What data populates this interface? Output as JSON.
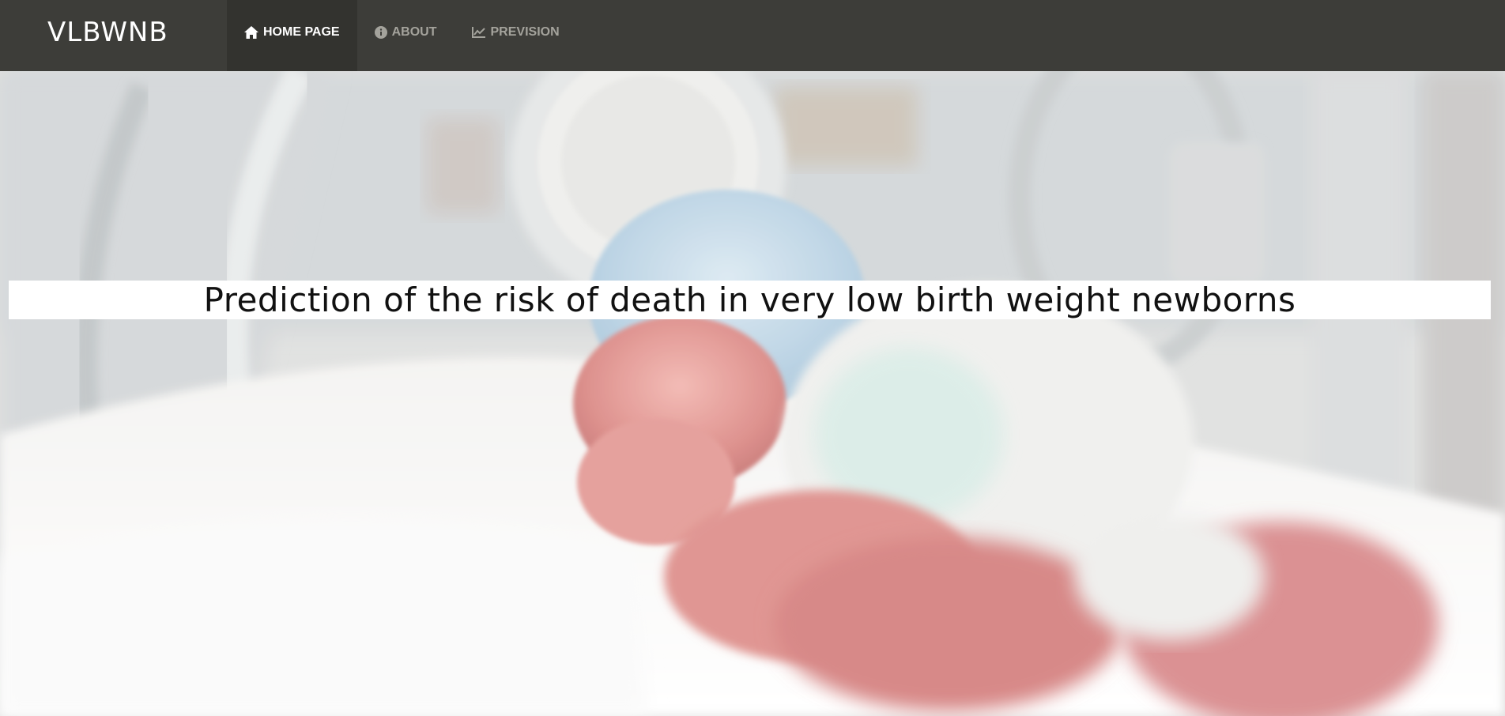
{
  "navbar": {
    "brand": "VLBWNB",
    "items": [
      {
        "label": "HOME PAGE",
        "icon": "home-icon",
        "active": true
      },
      {
        "label": "ABOUT",
        "icon": "info-circle-icon",
        "active": false
      },
      {
        "label": "PREVISION",
        "icon": "line-chart-icon",
        "active": false
      }
    ]
  },
  "hero": {
    "title": "Prediction of the risk of death in very low birth weight newborns",
    "background_image": "newborn-in-incubator-photo"
  },
  "colors": {
    "navbar_bg": "#3d3d39",
    "navbar_active_bg": "#33332f",
    "nav_text": "#a4a39c",
    "nav_active_text": "#ffffff",
    "title_band_bg": "#ffffff",
    "title_text": "#111111"
  }
}
